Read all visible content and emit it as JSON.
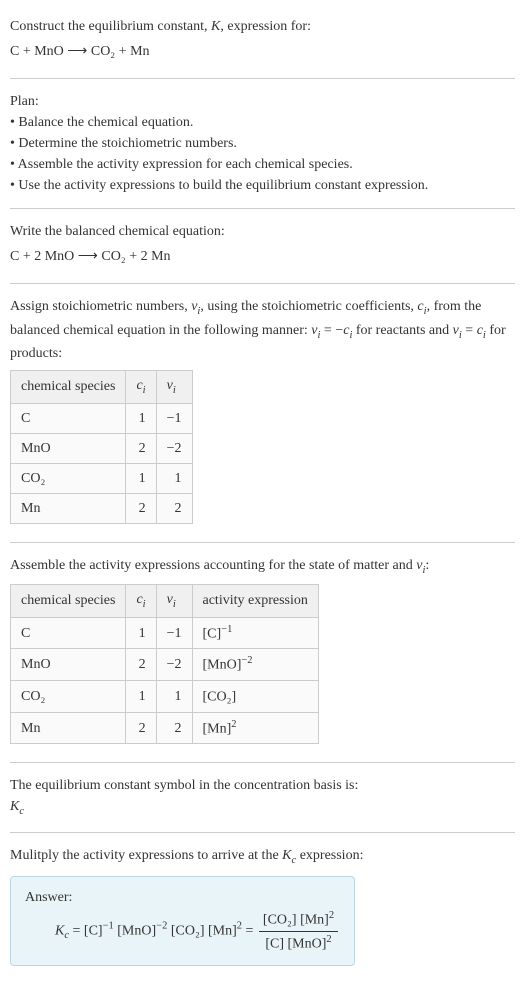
{
  "intro": {
    "line1": "Construct the equilibrium constant, ",
    "K": "K",
    "line1b": ", expression for:",
    "equation": "C + MnO  ⟶  CO₂ + Mn"
  },
  "plan": {
    "title": "Plan:",
    "items": [
      "Balance the chemical equation.",
      "Determine the stoichiometric numbers.",
      "Assemble the activity expression for each chemical species.",
      "Use the activity expressions to build the equilibrium constant expression."
    ]
  },
  "balanced": {
    "title": "Write the balanced chemical equation:",
    "equation": "C + 2 MnO  ⟶  CO₂ + 2 Mn"
  },
  "stoich": {
    "text1": "Assign stoichiometric numbers, ",
    "nu": "ν",
    "sub_i": "i",
    "text2": ", using the stoichiometric coefficients, ",
    "c": "c",
    "text3": ", from the balanced chemical equation in the following manner: ",
    "rel1a": "ν",
    "rel1b": " = −",
    "rel1c": "c",
    "text4": " for reactants and ",
    "rel2a": "ν",
    "rel2b": " = ",
    "rel2c": "c",
    "text5": " for products:",
    "headers": {
      "species": "chemical species",
      "ci": "c",
      "nui": "ν"
    },
    "rows": [
      {
        "species": "C",
        "ci": "1",
        "nui": "−1"
      },
      {
        "species": "MnO",
        "ci": "2",
        "nui": "−2"
      },
      {
        "species": "CO₂",
        "ci": "1",
        "nui": "1"
      },
      {
        "species": "Mn",
        "ci": "2",
        "nui": "2"
      }
    ]
  },
  "activity": {
    "text1": "Assemble the activity expressions accounting for the state of matter and ",
    "nu": "ν",
    "sub_i": "i",
    "text2": ":",
    "headers": {
      "species": "chemical species",
      "ci": "c",
      "nui": "ν",
      "act": "activity expression"
    },
    "rows": [
      {
        "species": "C",
        "ci": "1",
        "nui": "−1",
        "act_base": "[C]",
        "act_exp": "−1"
      },
      {
        "species": "MnO",
        "ci": "2",
        "nui": "−2",
        "act_base": "[MnO]",
        "act_exp": "−2"
      },
      {
        "species": "CO₂",
        "ci": "1",
        "nui": "1",
        "act_base": "[CO₂]",
        "act_exp": ""
      },
      {
        "species": "Mn",
        "ci": "2",
        "nui": "2",
        "act_base": "[Mn]",
        "act_exp": "2"
      }
    ]
  },
  "symbol": {
    "text": "The equilibrium constant symbol in the concentration basis is:",
    "Kc": "K",
    "Kc_sub": "c"
  },
  "multiply": {
    "text1": "Mulitply the activity expressions to arrive at the ",
    "Kc": "K",
    "Kc_sub": "c",
    "text2": " expression:"
  },
  "answer": {
    "label": "Answer:",
    "lhs_K": "K",
    "lhs_sub": "c",
    "eq": " = ",
    "p1_base": "[C]",
    "p1_exp": "−1",
    "p2_base": " [MnO]",
    "p2_exp": "−2",
    "p3_base": " [CO₂]",
    "p4_base": " [Mn]",
    "p4_exp": "2",
    "eq2": " = ",
    "frac_num1": "[CO₂] [Mn]",
    "frac_num_exp": "2",
    "frac_den1": "[C] [MnO]",
    "frac_den_exp": "2"
  }
}
